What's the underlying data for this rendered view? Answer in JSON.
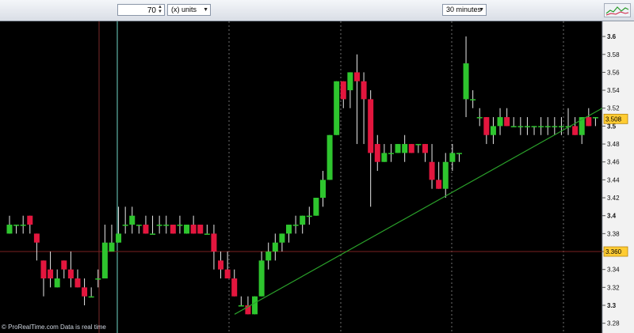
{
  "toolbar": {
    "units_value": "70",
    "units_label": "(x) units",
    "timeframe": "30 minutes",
    "chart_icon": "chart-thumbnail-icon"
  },
  "footer": {
    "text": "© ProRealTime.com  Data is real time"
  },
  "colors": {
    "up": "#2ec52e",
    "down": "#e3163e",
    "trendline": "#2aa02a",
    "grid": "#707070",
    "background": "#000000"
  },
  "chart_data": {
    "type": "candlestick",
    "title": "",
    "ylim": [
      3.27,
      3.62
    ],
    "y_ticks": [
      "3.28",
      "3.3",
      "3.32",
      "3.34",
      "3.36",
      "3.38",
      "3.4",
      "3.42",
      "3.44",
      "3.46",
      "3.48",
      "3.5",
      "3.52",
      "3.54",
      "3.56",
      "3.58",
      "3.6"
    ],
    "last_price_label": "3.508",
    "level_label": "3.360",
    "level_value": 3.36,
    "candles": [
      [
        3.38,
        3.4,
        3.38,
        3.39
      ],
      [
        3.39,
        3.39,
        3.38,
        3.39
      ],
      [
        3.39,
        3.4,
        3.38,
        3.39
      ],
      [
        3.4,
        3.4,
        3.38,
        3.39
      ],
      [
        3.38,
        3.38,
        3.35,
        3.37
      ],
      [
        3.35,
        3.35,
        3.31,
        3.33
      ],
      [
        3.34,
        3.36,
        3.32,
        3.33
      ],
      [
        3.32,
        3.34,
        3.32,
        3.33
      ],
      [
        3.35,
        3.35,
        3.33,
        3.34
      ],
      [
        3.34,
        3.36,
        3.32,
        3.33
      ],
      [
        3.33,
        3.34,
        3.32,
        3.32
      ],
      [
        3.32,
        3.33,
        3.3,
        3.31
      ],
      [
        3.31,
        3.32,
        3.31,
        3.31
      ],
      [
        3.33,
        3.34,
        3.32,
        3.33
      ],
      [
        3.33,
        3.39,
        3.33,
        3.37
      ],
      [
        3.36,
        3.39,
        3.36,
        3.37
      ],
      [
        3.37,
        3.41,
        3.37,
        3.38
      ],
      [
        3.39,
        3.41,
        3.38,
        3.39
      ],
      [
        3.39,
        3.41,
        3.38,
        3.4
      ],
      [
        3.39,
        3.39,
        3.38,
        3.39
      ],
      [
        3.39,
        3.4,
        3.38,
        3.38
      ],
      [
        3.38,
        3.4,
        3.38,
        3.38
      ],
      [
        3.39,
        3.4,
        3.38,
        3.39
      ],
      [
        3.39,
        3.4,
        3.38,
        3.39
      ],
      [
        3.39,
        3.39,
        3.38,
        3.38
      ],
      [
        3.39,
        3.4,
        3.38,
        3.39
      ],
      [
        3.38,
        3.39,
        3.38,
        3.39
      ],
      [
        3.39,
        3.4,
        3.38,
        3.38
      ],
      [
        3.39,
        3.39,
        3.38,
        3.38
      ],
      [
        3.38,
        3.39,
        3.38,
        3.38
      ],
      [
        3.38,
        3.39,
        3.34,
        3.36
      ],
      [
        3.35,
        3.36,
        3.33,
        3.34
      ],
      [
        3.34,
        3.36,
        3.33,
        3.33
      ],
      [
        3.33,
        3.34,
        3.31,
        3.31
      ],
      [
        3.3,
        3.31,
        3.3,
        3.3
      ],
      [
        3.3,
        3.31,
        3.29,
        3.29
      ],
      [
        3.29,
        3.31,
        3.29,
        3.31
      ],
      [
        3.31,
        3.36,
        3.31,
        3.35
      ],
      [
        3.35,
        3.37,
        3.34,
        3.36
      ],
      [
        3.36,
        3.38,
        3.35,
        3.37
      ],
      [
        3.37,
        3.38,
        3.36,
        3.38
      ],
      [
        3.38,
        3.39,
        3.37,
        3.39
      ],
      [
        3.39,
        3.4,
        3.38,
        3.39
      ],
      [
        3.39,
        3.4,
        3.38,
        3.4
      ],
      [
        3.4,
        3.41,
        3.39,
        3.4
      ],
      [
        3.4,
        3.42,
        3.4,
        3.42
      ],
      [
        3.42,
        3.45,
        3.41,
        3.44
      ],
      [
        3.44,
        3.49,
        3.44,
        3.49
      ],
      [
        3.49,
        3.55,
        3.49,
        3.55
      ],
      [
        3.55,
        3.55,
        3.52,
        3.53
      ],
      [
        3.54,
        3.56,
        3.52,
        3.56
      ],
      [
        3.56,
        3.58,
        3.48,
        3.55
      ],
      [
        3.55,
        3.56,
        3.48,
        3.53
      ],
      [
        3.53,
        3.54,
        3.41,
        3.47
      ],
      [
        3.48,
        3.49,
        3.45,
        3.46
      ],
      [
        3.46,
        3.48,
        3.46,
        3.47
      ],
      [
        3.47,
        3.48,
        3.46,
        3.47
      ],
      [
        3.47,
        3.48,
        3.47,
        3.48
      ],
      [
        3.47,
        3.49,
        3.46,
        3.48
      ],
      [
        3.48,
        3.48,
        3.47,
        3.47
      ],
      [
        3.48,
        3.48,
        3.47,
        3.48
      ],
      [
        3.48,
        3.48,
        3.46,
        3.47
      ],
      [
        3.46,
        3.48,
        3.43,
        3.44
      ],
      [
        3.44,
        3.46,
        3.43,
        3.43
      ],
      [
        3.43,
        3.47,
        3.42,
        3.46
      ],
      [
        3.46,
        3.48,
        3.45,
        3.47
      ],
      [
        3.47,
        3.47,
        3.46,
        3.47
      ],
      [
        3.53,
        3.6,
        3.51,
        3.57
      ],
      [
        3.53,
        3.54,
        3.52,
        3.53
      ],
      [
        3.51,
        3.52,
        3.5,
        3.51
      ],
      [
        3.51,
        3.51,
        3.48,
        3.49
      ],
      [
        3.49,
        3.51,
        3.48,
        3.5
      ],
      [
        3.5,
        3.52,
        3.49,
        3.51
      ],
      [
        3.51,
        3.52,
        3.5,
        3.5
      ],
      [
        3.5,
        3.51,
        3.5,
        3.5
      ],
      [
        3.5,
        3.51,
        3.49,
        3.5
      ],
      [
        3.5,
        3.51,
        3.49,
        3.5
      ],
      [
        3.5,
        3.5,
        3.49,
        3.5
      ],
      [
        3.5,
        3.51,
        3.49,
        3.5
      ],
      [
        3.5,
        3.51,
        3.49,
        3.5
      ],
      [
        3.5,
        3.51,
        3.49,
        3.5
      ],
      [
        3.5,
        3.51,
        3.49,
        3.5
      ],
      [
        3.5,
        3.52,
        3.49,
        3.5
      ],
      [
        3.5,
        3.51,
        3.49,
        3.49
      ],
      [
        3.49,
        3.51,
        3.48,
        3.51
      ],
      [
        3.51,
        3.52,
        3.5,
        3.5
      ],
      [
        3.51,
        3.51,
        3.5,
        3.51
      ]
    ],
    "trendline": {
      "start": [
        3.29
      ],
      "end": [
        3.52
      ]
    },
    "grid": "vertical session separators"
  }
}
